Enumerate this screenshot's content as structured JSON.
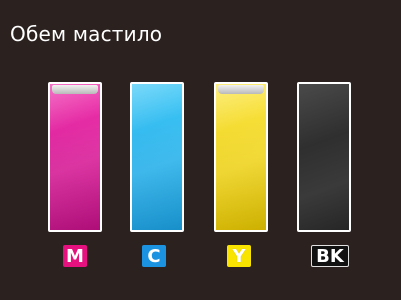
{
  "title": "Обем мастило",
  "cartridges": [
    {
      "key": "magenta",
      "label": "M",
      "level": 1.0,
      "color": "#ef26a8",
      "dark": "#c20f86"
    },
    {
      "key": "cyan",
      "label": "C",
      "level": 1.0,
      "color": "#33c4f6",
      "dark": "#1a9fe0"
    },
    {
      "key": "yellow",
      "label": "Y",
      "level": 1.0,
      "color": "#fbe43a",
      "dark": "#e4c400"
    },
    {
      "key": "black",
      "label": "BK",
      "level": 0.0,
      "color": "#3a3a3a",
      "dark": "#262626"
    }
  ],
  "colors": {
    "background": "#2b2220",
    "badge_magenta": "#e4117f",
    "badge_cyan": "#1b93e0",
    "badge_yellow": "#f8e400",
    "badge_black": "#111111"
  }
}
